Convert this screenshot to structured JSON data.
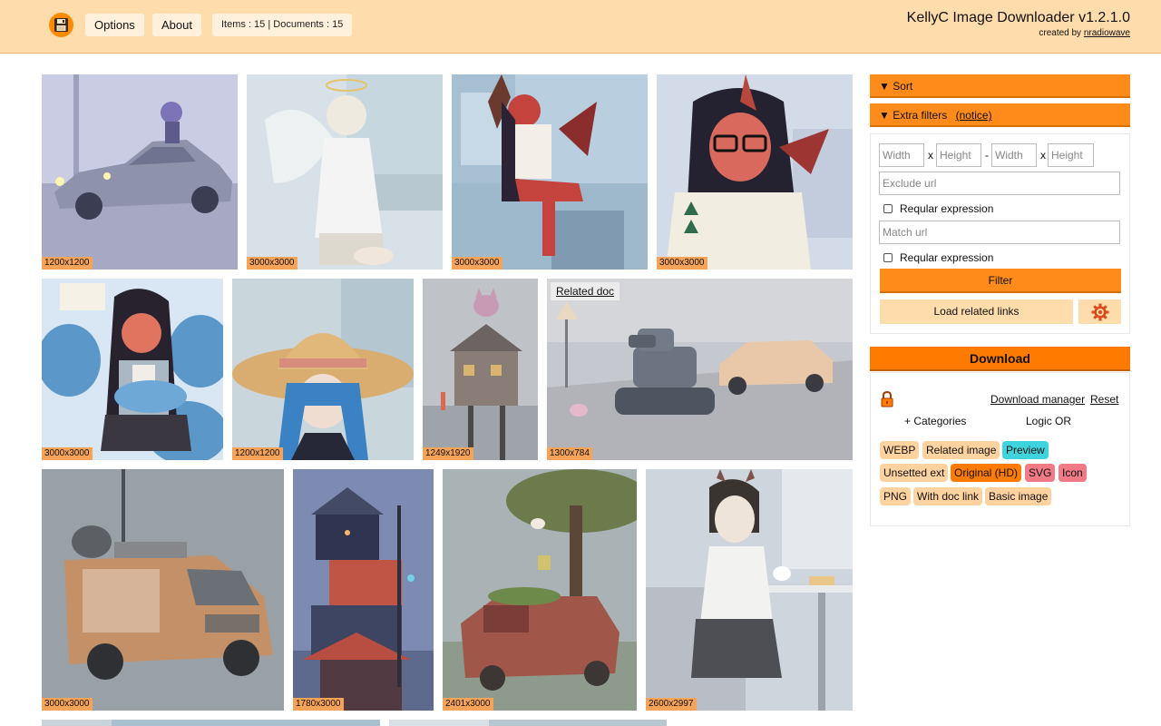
{
  "header": {
    "options_label": "Options",
    "about_label": "About",
    "stats": "Items : 15 | Documents : 15",
    "app_title": "KellyC Image Downloader v1.2.1.0",
    "created_by_prefix": "created by",
    "author": "nradiowave",
    "logo_icon": "floppy-disk-icon"
  },
  "gallery": {
    "related_doc_label": "Related doc",
    "images": [
      {
        "dimensions": "1200x1200",
        "subject": "anime girl on silver car"
      },
      {
        "dimensions": "3000x3000",
        "subject": "crying angel girl"
      },
      {
        "dimensions": "3000x3000",
        "subject": "red demon girl in kitchen"
      },
      {
        "dimensions": "3000x3000",
        "subject": "demon girl with glasses"
      },
      {
        "dimensions": "3000x3000",
        "subject": "demon girl hugging shark plushies"
      },
      {
        "dimensions": "1200x1200",
        "subject": "girl with straw hat"
      },
      {
        "dimensions": "1249x1920",
        "subject": "cat on tower house"
      },
      {
        "dimensions": "1300x784",
        "subject": "tank and car on street"
      },
      {
        "dimensions": "3000x3000",
        "subject": "orange van"
      },
      {
        "dimensions": "1780x3000",
        "subject": "stacked tower house"
      },
      {
        "dimensions": "2401x3000",
        "subject": "abandoned truck with tree"
      },
      {
        "dimensions": "2600x2997",
        "subject": "demon girl at table"
      }
    ]
  },
  "sidebar": {
    "sort_label": "▼ Sort",
    "extra_filters_label": "▼ Extra filters",
    "notice_label": "(notice)",
    "min_width_placeholder": "Width",
    "min_height_placeholder": "Height",
    "max_width_placeholder": "Width",
    "max_height_placeholder": "Height",
    "x_sep": "x",
    "dash_sep": "-",
    "exclude_placeholder": "Exclude url",
    "match_placeholder": "Match url",
    "regex_label_1": "Reqular expression",
    "regex_label_2": "Reqular expression",
    "filter_label": "Filter",
    "load_related_label": "Load related links",
    "download_label": "Download",
    "download_manager_label": "Download manager",
    "reset_label": "Reset",
    "categories_label": "+ Categories",
    "logic_label": "Logic OR",
    "tags": [
      {
        "label": "WEBP",
        "state": "off"
      },
      {
        "label": "Related image",
        "state": "off"
      },
      {
        "label": "Preview",
        "state": "cyan"
      },
      {
        "label": "Unsetted ext",
        "state": "off"
      },
      {
        "label": "Original (HD)",
        "state": "on"
      },
      {
        "label": "SVG",
        "state": "red"
      },
      {
        "label": "Icon",
        "state": "red"
      },
      {
        "label": "PNG",
        "state": "off"
      },
      {
        "label": "With doc link",
        "state": "off"
      },
      {
        "label": "Basic image",
        "state": "off"
      }
    ]
  },
  "colors": {
    "header_bg": "#ffdcab",
    "accent": "#ff8c1a",
    "download": "#ff7b00",
    "badge": "#f6a35a",
    "tag_cyan": "#3ed4de",
    "tag_red": "#f07a86"
  }
}
